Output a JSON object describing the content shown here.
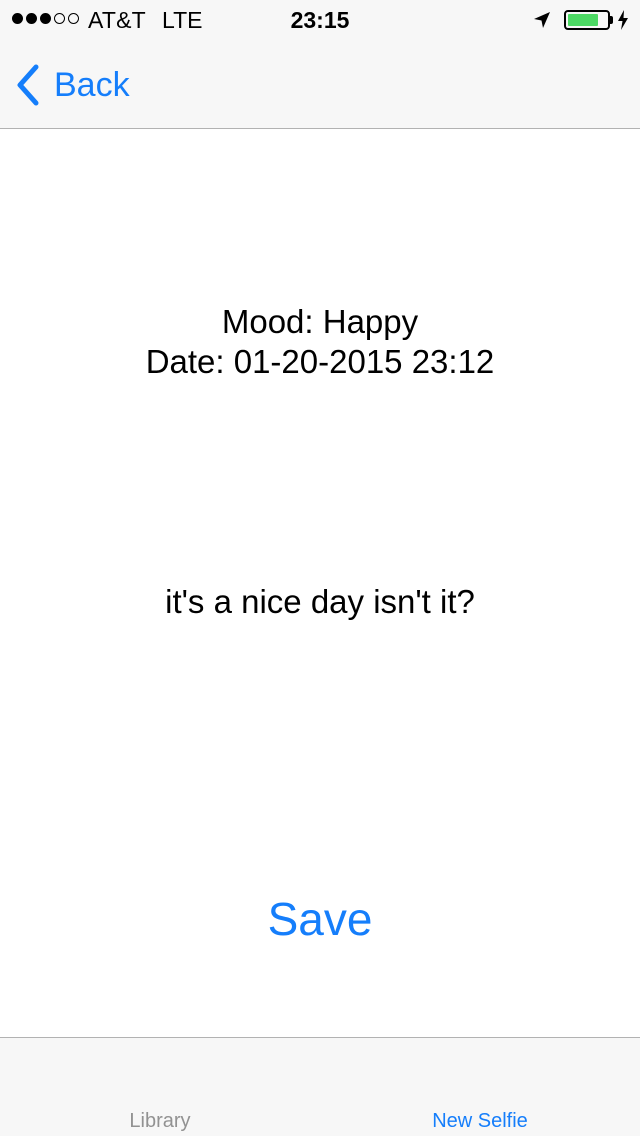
{
  "status_bar": {
    "signal_bars": 3,
    "signal_total": 5,
    "carrier": "AT&T",
    "network": "LTE",
    "time": "23:15",
    "battery_level": 0.8,
    "icons": [
      "location-arrow-icon",
      "battery-icon",
      "charging-bolt-icon"
    ]
  },
  "nav": {
    "back_label": "Back",
    "back_icon": "chevron-left-icon"
  },
  "content": {
    "mood_line": "Mood: Happy",
    "date_line": "Date: 01-20-2015 23:12",
    "note": "it's a nice day isn't it?",
    "save_label": "Save"
  },
  "tab_bar": {
    "tabs": [
      {
        "label": "Library",
        "active": false
      },
      {
        "label": "New Selfie",
        "active": true
      }
    ]
  },
  "colors": {
    "accent": "#157efb",
    "battery": "#4cd964",
    "bar_background": "#f7f7f7",
    "inactive_tab": "#929292"
  }
}
